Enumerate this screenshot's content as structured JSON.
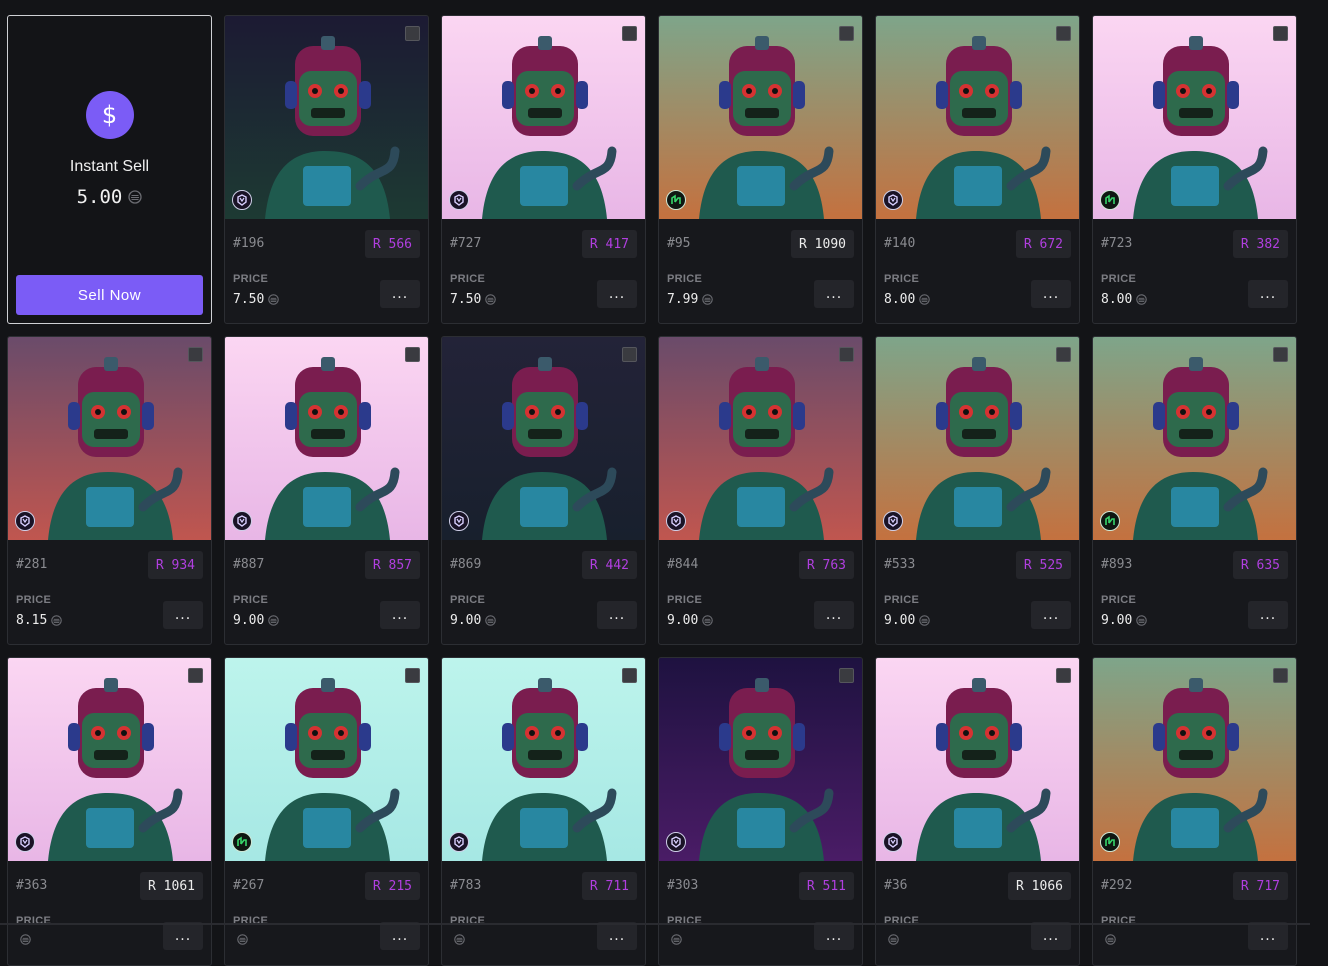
{
  "instant_sell": {
    "title": "Instant Sell",
    "price": "5.00",
    "button_label": "Sell Now",
    "icon": "dollar-icon"
  },
  "price_label": "PRICE",
  "more_label": "...",
  "colors": {
    "accent": "#7b5cf6",
    "rank_purple": "#b13fe0",
    "rank_white": "#ececec"
  },
  "items": [
    {
      "id": "#196",
      "rank": "R 566",
      "price": "7.50",
      "badge": "purple",
      "rank_color": "purple",
      "bg": "dark-green"
    },
    {
      "id": "#727",
      "rank": "R 417",
      "price": "7.50",
      "badge": "purple",
      "rank_color": "purple",
      "bg": "pink"
    },
    {
      "id": "#95",
      "rank": "R 1090",
      "price": "7.99",
      "badge": "green",
      "rank_color": "white",
      "bg": "sunset"
    },
    {
      "id": "#140",
      "rank": "R 672",
      "price": "8.00",
      "badge": "purple",
      "rank_color": "purple",
      "bg": "sunset"
    },
    {
      "id": "#723",
      "rank": "R 382",
      "price": "8.00",
      "badge": "green",
      "rank_color": "purple",
      "bg": "pink"
    },
    {
      "id": "#281",
      "rank": "R 934",
      "price": "8.15",
      "badge": "purple",
      "rank_color": "purple",
      "bg": "mars"
    },
    {
      "id": "#887",
      "rank": "R 857",
      "price": "9.00",
      "badge": "purple",
      "rank_color": "purple",
      "bg": "pink"
    },
    {
      "id": "#869",
      "rank": "R 442",
      "price": "9.00",
      "badge": "purple",
      "rank_color": "purple",
      "bg": "night"
    },
    {
      "id": "#844",
      "rank": "R 763",
      "price": "9.00",
      "badge": "purple",
      "rank_color": "purple",
      "bg": "mars"
    },
    {
      "id": "#533",
      "rank": "R 525",
      "price": "9.00",
      "badge": "purple",
      "rank_color": "purple",
      "bg": "sunset"
    },
    {
      "id": "#893",
      "rank": "R 635",
      "price": "9.00",
      "badge": "green",
      "rank_color": "purple",
      "bg": "sunset"
    },
    {
      "id": "#363",
      "rank": "R 1061",
      "price": "",
      "badge": "purple",
      "rank_color": "white",
      "bg": "pink"
    },
    {
      "id": "#267",
      "rank": "R 215",
      "price": "",
      "badge": "green",
      "rank_color": "purple",
      "bg": "mint"
    },
    {
      "id": "#783",
      "rank": "R 711",
      "price": "",
      "badge": "purple",
      "rank_color": "purple",
      "bg": "mint"
    },
    {
      "id": "#303",
      "rank": "R 511",
      "price": "",
      "badge": "purple",
      "rank_color": "purple",
      "bg": "synth"
    },
    {
      "id": "#36",
      "rank": "R 1066",
      "price": "",
      "badge": "purple",
      "rank_color": "white",
      "bg": "pink"
    },
    {
      "id": "#292",
      "rank": "R 717",
      "price": "",
      "badge": "green",
      "rank_color": "purple",
      "bg": "sunset"
    }
  ]
}
